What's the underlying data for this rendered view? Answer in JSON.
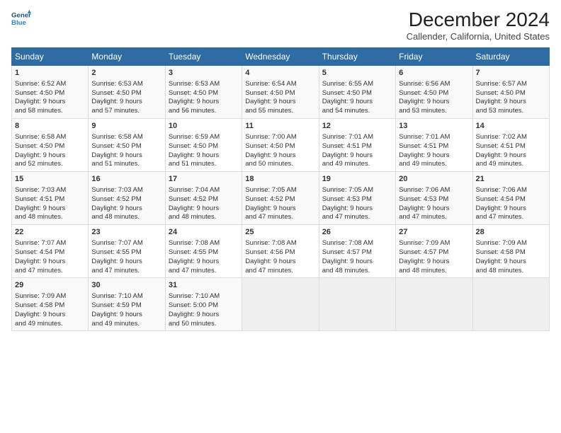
{
  "header": {
    "logo_line1": "General",
    "logo_line2": "Blue",
    "main_title": "December 2024",
    "subtitle": "Callender, California, United States"
  },
  "weekdays": [
    "Sunday",
    "Monday",
    "Tuesday",
    "Wednesday",
    "Thursday",
    "Friday",
    "Saturday"
  ],
  "weeks": [
    [
      {
        "day": "1",
        "lines": [
          "Sunrise: 6:52 AM",
          "Sunset: 4:50 PM",
          "Daylight: 9 hours",
          "and 58 minutes."
        ]
      },
      {
        "day": "2",
        "lines": [
          "Sunrise: 6:53 AM",
          "Sunset: 4:50 PM",
          "Daylight: 9 hours",
          "and 57 minutes."
        ]
      },
      {
        "day": "3",
        "lines": [
          "Sunrise: 6:53 AM",
          "Sunset: 4:50 PM",
          "Daylight: 9 hours",
          "and 56 minutes."
        ]
      },
      {
        "day": "4",
        "lines": [
          "Sunrise: 6:54 AM",
          "Sunset: 4:50 PM",
          "Daylight: 9 hours",
          "and 55 minutes."
        ]
      },
      {
        "day": "5",
        "lines": [
          "Sunrise: 6:55 AM",
          "Sunset: 4:50 PM",
          "Daylight: 9 hours",
          "and 54 minutes."
        ]
      },
      {
        "day": "6",
        "lines": [
          "Sunrise: 6:56 AM",
          "Sunset: 4:50 PM",
          "Daylight: 9 hours",
          "and 53 minutes."
        ]
      },
      {
        "day": "7",
        "lines": [
          "Sunrise: 6:57 AM",
          "Sunset: 4:50 PM",
          "Daylight: 9 hours",
          "and 53 minutes."
        ]
      }
    ],
    [
      {
        "day": "8",
        "lines": [
          "Sunrise: 6:58 AM",
          "Sunset: 4:50 PM",
          "Daylight: 9 hours",
          "and 52 minutes."
        ]
      },
      {
        "day": "9",
        "lines": [
          "Sunrise: 6:58 AM",
          "Sunset: 4:50 PM",
          "Daylight: 9 hours",
          "and 51 minutes."
        ]
      },
      {
        "day": "10",
        "lines": [
          "Sunrise: 6:59 AM",
          "Sunset: 4:50 PM",
          "Daylight: 9 hours",
          "and 51 minutes."
        ]
      },
      {
        "day": "11",
        "lines": [
          "Sunrise: 7:00 AM",
          "Sunset: 4:50 PM",
          "Daylight: 9 hours",
          "and 50 minutes."
        ]
      },
      {
        "day": "12",
        "lines": [
          "Sunrise: 7:01 AM",
          "Sunset: 4:51 PM",
          "Daylight: 9 hours",
          "and 49 minutes."
        ]
      },
      {
        "day": "13",
        "lines": [
          "Sunrise: 7:01 AM",
          "Sunset: 4:51 PM",
          "Daylight: 9 hours",
          "and 49 minutes."
        ]
      },
      {
        "day": "14",
        "lines": [
          "Sunrise: 7:02 AM",
          "Sunset: 4:51 PM",
          "Daylight: 9 hours",
          "and 49 minutes."
        ]
      }
    ],
    [
      {
        "day": "15",
        "lines": [
          "Sunrise: 7:03 AM",
          "Sunset: 4:51 PM",
          "Daylight: 9 hours",
          "and 48 minutes."
        ]
      },
      {
        "day": "16",
        "lines": [
          "Sunrise: 7:03 AM",
          "Sunset: 4:52 PM",
          "Daylight: 9 hours",
          "and 48 minutes."
        ]
      },
      {
        "day": "17",
        "lines": [
          "Sunrise: 7:04 AM",
          "Sunset: 4:52 PM",
          "Daylight: 9 hours",
          "and 48 minutes."
        ]
      },
      {
        "day": "18",
        "lines": [
          "Sunrise: 7:05 AM",
          "Sunset: 4:52 PM",
          "Daylight: 9 hours",
          "and 47 minutes."
        ]
      },
      {
        "day": "19",
        "lines": [
          "Sunrise: 7:05 AM",
          "Sunset: 4:53 PM",
          "Daylight: 9 hours",
          "and 47 minutes."
        ]
      },
      {
        "day": "20",
        "lines": [
          "Sunrise: 7:06 AM",
          "Sunset: 4:53 PM",
          "Daylight: 9 hours",
          "and 47 minutes."
        ]
      },
      {
        "day": "21",
        "lines": [
          "Sunrise: 7:06 AM",
          "Sunset: 4:54 PM",
          "Daylight: 9 hours",
          "and 47 minutes."
        ]
      }
    ],
    [
      {
        "day": "22",
        "lines": [
          "Sunrise: 7:07 AM",
          "Sunset: 4:54 PM",
          "Daylight: 9 hours",
          "and 47 minutes."
        ]
      },
      {
        "day": "23",
        "lines": [
          "Sunrise: 7:07 AM",
          "Sunset: 4:55 PM",
          "Daylight: 9 hours",
          "and 47 minutes."
        ]
      },
      {
        "day": "24",
        "lines": [
          "Sunrise: 7:08 AM",
          "Sunset: 4:55 PM",
          "Daylight: 9 hours",
          "and 47 minutes."
        ]
      },
      {
        "day": "25",
        "lines": [
          "Sunrise: 7:08 AM",
          "Sunset: 4:56 PM",
          "Daylight: 9 hours",
          "and 47 minutes."
        ]
      },
      {
        "day": "26",
        "lines": [
          "Sunrise: 7:08 AM",
          "Sunset: 4:57 PM",
          "Daylight: 9 hours",
          "and 48 minutes."
        ]
      },
      {
        "day": "27",
        "lines": [
          "Sunrise: 7:09 AM",
          "Sunset: 4:57 PM",
          "Daylight: 9 hours",
          "and 48 minutes."
        ]
      },
      {
        "day": "28",
        "lines": [
          "Sunrise: 7:09 AM",
          "Sunset: 4:58 PM",
          "Daylight: 9 hours",
          "and 48 minutes."
        ]
      }
    ],
    [
      {
        "day": "29",
        "lines": [
          "Sunrise: 7:09 AM",
          "Sunset: 4:58 PM",
          "Daylight: 9 hours",
          "and 49 minutes."
        ]
      },
      {
        "day": "30",
        "lines": [
          "Sunrise: 7:10 AM",
          "Sunset: 4:59 PM",
          "Daylight: 9 hours",
          "and 49 minutes."
        ]
      },
      {
        "day": "31",
        "lines": [
          "Sunrise: 7:10 AM",
          "Sunset: 5:00 PM",
          "Daylight: 9 hours",
          "and 50 minutes."
        ]
      },
      null,
      null,
      null,
      null
    ]
  ]
}
